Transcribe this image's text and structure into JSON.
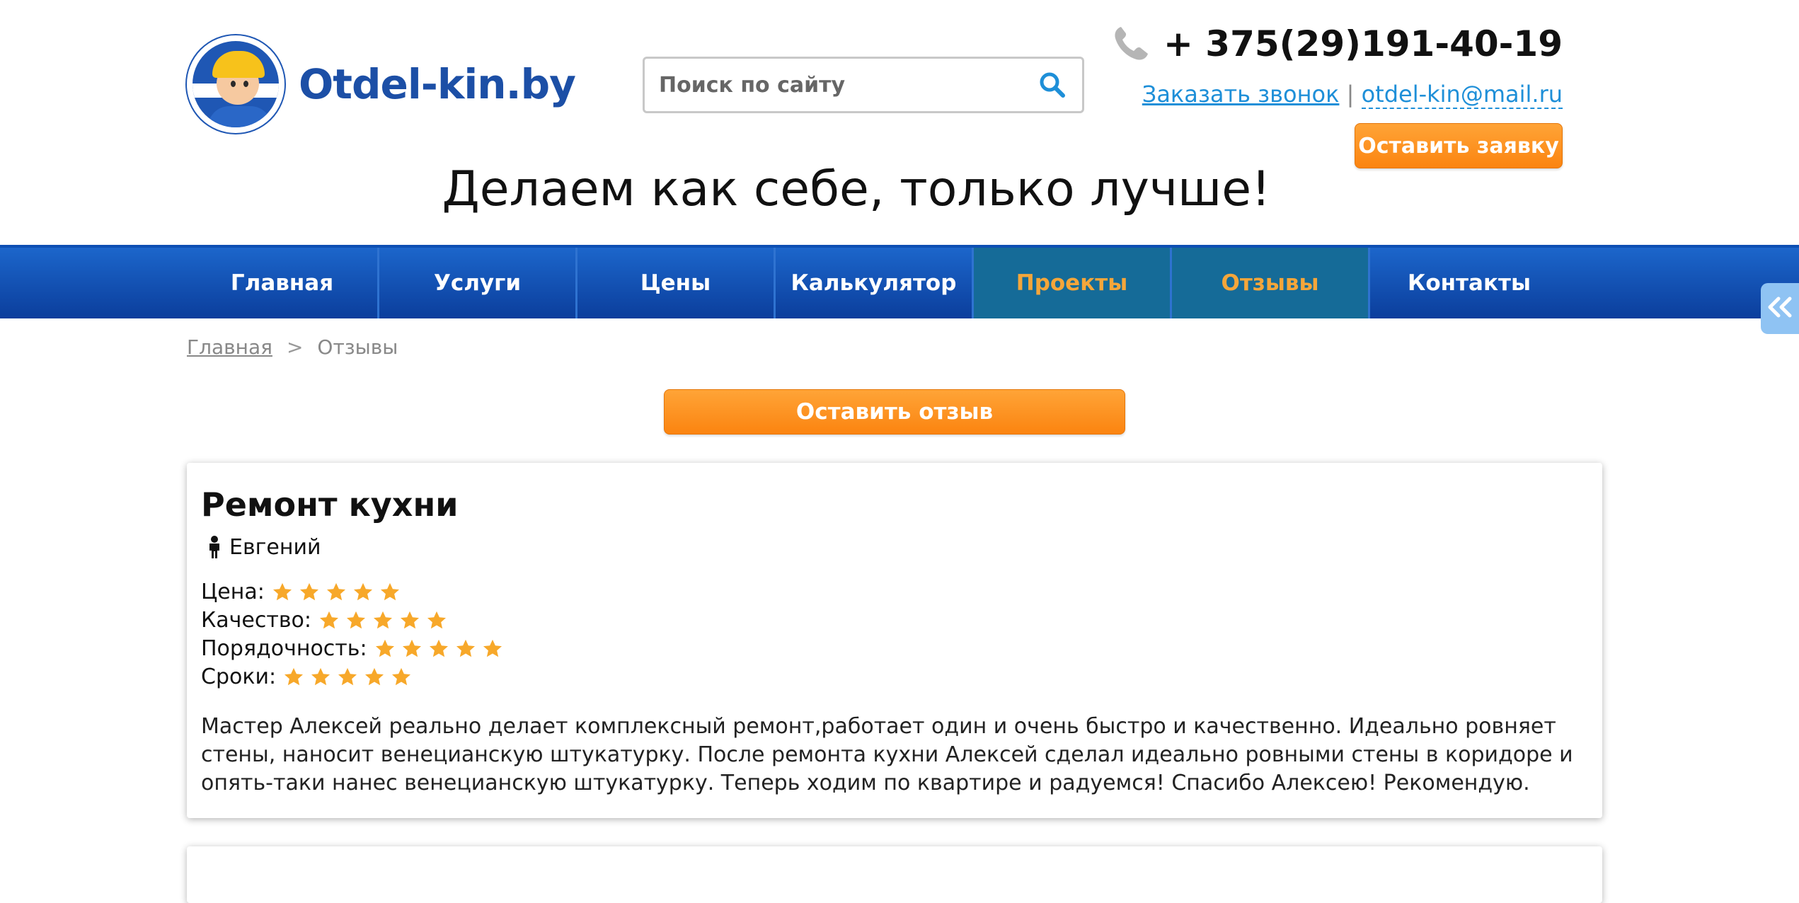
{
  "header": {
    "logo_text": "Otdel-kin.by",
    "search_placeholder": "Поиск по сайту",
    "phone": "+ 375(29)191-40-19",
    "callback_link": "Заказать звонок",
    "separator": "|",
    "email": "otdel-kin@mail.ru",
    "request_button": "Оставить заявку",
    "slogan": "Делаем как себе, только лучше!"
  },
  "nav": {
    "items": [
      {
        "label": "Главная",
        "active": false
      },
      {
        "label": "Услуги",
        "active": false
      },
      {
        "label": "Цены",
        "active": false
      },
      {
        "label": "Калькулятор",
        "active": false
      },
      {
        "label": "Проекты",
        "active": true
      },
      {
        "label": "Отзывы",
        "active": true
      },
      {
        "label": "Контакты",
        "active": false
      }
    ]
  },
  "breadcrumb": {
    "home": "Главная",
    "separator": ">",
    "current": "Отзывы"
  },
  "review_button": "Оставить отзыв",
  "review": {
    "title": "Ремонт кухни",
    "author": "Евгений",
    "ratings": [
      {
        "label": "Цена:",
        "stars": 5
      },
      {
        "label": "Качество:",
        "stars": 5
      },
      {
        "label": "Порядочность:",
        "stars": 5
      },
      {
        "label": "Сроки:",
        "stars": 5
      }
    ],
    "text": "Мастер Алексей реально делает комплексный ремонт,работает один и очень быстро и качественно. Идеально ровняет стены, наносит венецианскую штукатурку. После ремонта кухни Алексей сделал идеально ровными стены в коридоре и опять-таки нанес венецианскую штукатурку. Теперь ходим по квартире и радуемся! Спасибо Алексею! Рекомендую."
  },
  "colors": {
    "brand_blue": "#1c4fa6",
    "nav_blue": "#0b3e9c",
    "nav_active_bg": "#156b98",
    "accent_orange": "#fb8410",
    "link_blue": "#1e8fd8",
    "star_color": "#f7a82a"
  },
  "icons": {
    "search": "search-icon",
    "phone": "phone-icon",
    "person": "person-icon",
    "star": "star-icon",
    "side_tab": "double-chevron-left-icon"
  }
}
